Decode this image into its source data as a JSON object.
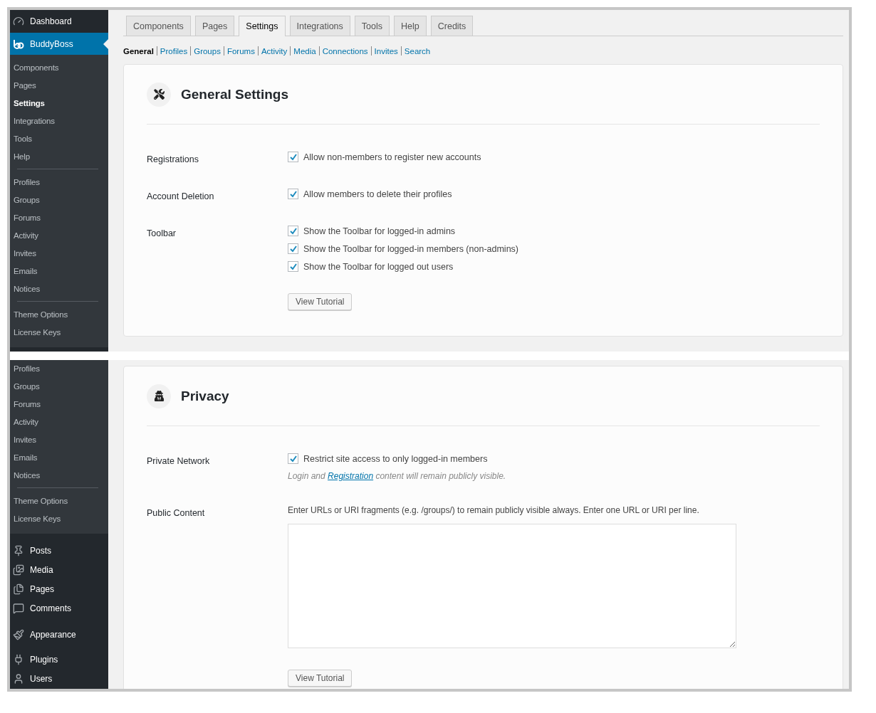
{
  "screens": [
    {
      "sidebar": {
        "menu_top": [
          {
            "label": "Dashboard",
            "selected": false
          },
          {
            "label": "BuddyBoss",
            "selected": true
          }
        ],
        "submenu_groups": [
          [
            {
              "label": "Components",
              "selected": false
            },
            {
              "label": "Pages",
              "selected": false
            },
            {
              "label": "Settings",
              "selected": true
            },
            {
              "label": "Integrations",
              "selected": false
            },
            {
              "label": "Tools",
              "selected": false
            },
            {
              "label": "Help",
              "selected": false
            }
          ],
          [
            {
              "label": "Profiles",
              "selected": false
            },
            {
              "label": "Groups",
              "selected": false
            },
            {
              "label": "Forums",
              "selected": false
            },
            {
              "label": "Activity",
              "selected": false
            },
            {
              "label": "Invites",
              "selected": false
            },
            {
              "label": "Emails",
              "selected": false
            },
            {
              "label": "Notices",
              "selected": false
            }
          ],
          [
            {
              "label": "Theme Options",
              "selected": false
            },
            {
              "label": "License Keys",
              "selected": false
            }
          ]
        ]
      },
      "tabs": [
        {
          "label": "Components",
          "selected": false
        },
        {
          "label": "Pages",
          "selected": false
        },
        {
          "label": "Settings",
          "selected": true
        },
        {
          "label": "Integrations",
          "selected": false
        },
        {
          "label": "Tools",
          "selected": false
        },
        {
          "label": "Help",
          "selected": false
        },
        {
          "label": "Credits",
          "selected": false
        }
      ],
      "subnav": [
        {
          "label": "General",
          "selected": true
        },
        {
          "label": "Profiles",
          "selected": false
        },
        {
          "label": "Groups",
          "selected": false
        },
        {
          "label": "Forums",
          "selected": false
        },
        {
          "label": "Activity",
          "selected": false
        },
        {
          "label": "Media",
          "selected": false
        },
        {
          "label": "Connections",
          "selected": false
        },
        {
          "label": "Invites",
          "selected": false
        },
        {
          "label": "Search",
          "selected": false
        }
      ],
      "card": {
        "title": "General Settings",
        "rows": [
          {
            "label": "Registrations",
            "kind": "checkboxes",
            "options": [
              {
                "text": "Allow non-members to register new accounts",
                "checked": true
              }
            ]
          },
          {
            "label": "Account Deletion",
            "kind": "checkboxes",
            "options": [
              {
                "text": "Allow members to delete their profiles",
                "checked": true
              }
            ]
          },
          {
            "label": "Toolbar",
            "kind": "checkboxes",
            "options": [
              {
                "text": "Show the Toolbar for logged-in admins",
                "checked": true
              },
              {
                "text": "Show the Toolbar for logged-in members (non-admins)",
                "checked": true
              },
              {
                "text": "Show the Toolbar for logged out users",
                "checked": true
              }
            ],
            "button": "View Tutorial"
          }
        ]
      }
    },
    {
      "sidebar": {
        "submenu_groups": [
          [
            {
              "label": "Profiles",
              "selected": false
            },
            {
              "label": "Groups",
              "selected": false
            },
            {
              "label": "Forums",
              "selected": false
            },
            {
              "label": "Activity",
              "selected": false
            },
            {
              "label": "Invites",
              "selected": false
            },
            {
              "label": "Emails",
              "selected": false
            },
            {
              "label": "Notices",
              "selected": false
            }
          ],
          [
            {
              "label": "Theme Options",
              "selected": false
            },
            {
              "label": "License Keys",
              "selected": false
            }
          ]
        ],
        "menu_bottom": [
          {
            "label": "Posts",
            "selected": false
          },
          {
            "label": "Media",
            "selected": false
          },
          {
            "label": "Pages",
            "selected": false
          },
          {
            "label": "Comments",
            "selected": false
          },
          {
            "label": "Appearance",
            "selected": false
          },
          {
            "label": "Plugins",
            "selected": false
          },
          {
            "label": "Users",
            "selected": false
          }
        ]
      },
      "card": {
        "title": "Privacy",
        "rows": [
          {
            "label": "Private Network",
            "kind": "checkboxes",
            "options": [
              {
                "text": "Restrict site access to only logged-in members",
                "checked": true
              }
            ],
            "note": {
              "before": "Login and",
              "link": "Registration",
              "after": "content will remain publicly visible."
            }
          },
          {
            "label": "Public Content",
            "kind": "textarea",
            "description": "Enter URLs or URI fragments (e.g. /groups/) to remain publicly visible always. Enter one URL or URI per line.",
            "button": "View Tutorial"
          }
        ]
      }
    }
  ]
}
